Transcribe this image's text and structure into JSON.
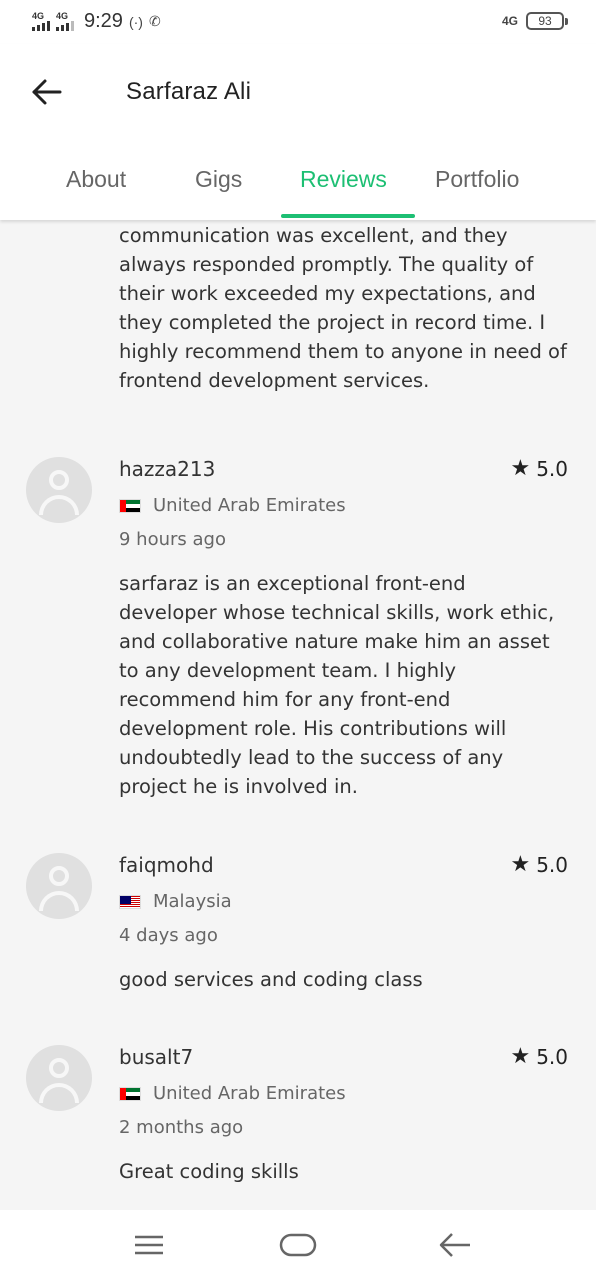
{
  "status_bar": {
    "signal1_label": "4G",
    "signal2_label": "4G",
    "time": "9:29",
    "hotspot_icon": "(·)",
    "whatsapp_icon": "✆",
    "network_label": "4G",
    "battery": "93"
  },
  "header": {
    "back_icon": "arrow-left-icon",
    "title": "Sarfaraz Ali"
  },
  "tabs": [
    {
      "label": "About",
      "active": false
    },
    {
      "label": "Gigs",
      "active": false
    },
    {
      "label": "Reviews",
      "active": true
    },
    {
      "label": "Portfolio",
      "active": false
    }
  ],
  "partial_review": {
    "text": "by this frontend developer. Their communication was excellent, and they always responded promptly. The quality of their work exceeded my expectations, and they completed the project in record time. I highly recommend them to anyone in need of frontend development services."
  },
  "reviews": [
    {
      "username": "hazza213",
      "rating": "5.0",
      "country": "United Arab Emirates",
      "time": "9 hours ago",
      "text": "sarfaraz is an exceptional front-end developer whose technical skills, work ethic, and collaborative nature make him an asset to any development team. I highly recommend him for any front-end development role. His contributions will undoubtedly lead to the success of any project he is involved in."
    },
    {
      "username": "faiqmohd",
      "rating": "5.0",
      "country": "Malaysia",
      "time": "4 days ago",
      "text": "good services and coding class"
    },
    {
      "username": "busalt7",
      "rating": "5.0",
      "country": "United Arab Emirates",
      "time": "2 months ago",
      "text": "Great coding skills"
    }
  ],
  "star_glyph": "★",
  "colors": {
    "accent": "#1dbf73",
    "text": "#333333",
    "muted": "#666666",
    "background": "#f5f5f5"
  }
}
